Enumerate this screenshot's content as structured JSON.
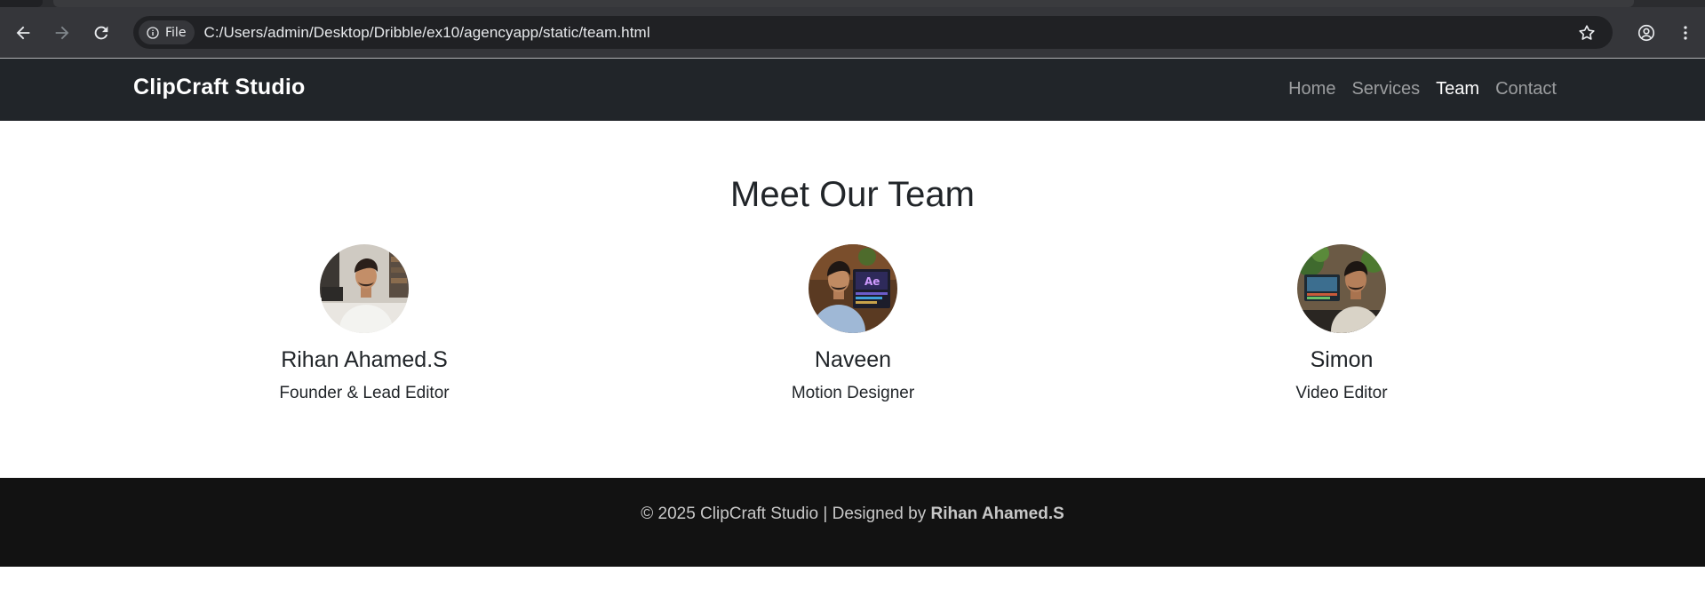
{
  "browser": {
    "chip_label": "File",
    "url": "C:/Users/admin/Desktop/Dribble/ex10/agencyapp/static/team.html"
  },
  "nav": {
    "brand": "ClipCraft Studio",
    "links": [
      {
        "label": "Home",
        "active": false
      },
      {
        "label": "Services",
        "active": false
      },
      {
        "label": "Team",
        "active": true
      },
      {
        "label": "Contact",
        "active": false
      }
    ]
  },
  "main": {
    "heading": "Meet Our Team",
    "members": [
      {
        "name": "Rihan Ahamed.S",
        "role": "Founder & Lead Editor"
      },
      {
        "name": "Naveen",
        "role": "Motion Designer"
      },
      {
        "name": "Simon",
        "role": "Video Editor"
      }
    ]
  },
  "footer": {
    "prefix": "© 2025 ClipCraft Studio | Designed by ",
    "author": "Rihan Ahamed.S"
  }
}
